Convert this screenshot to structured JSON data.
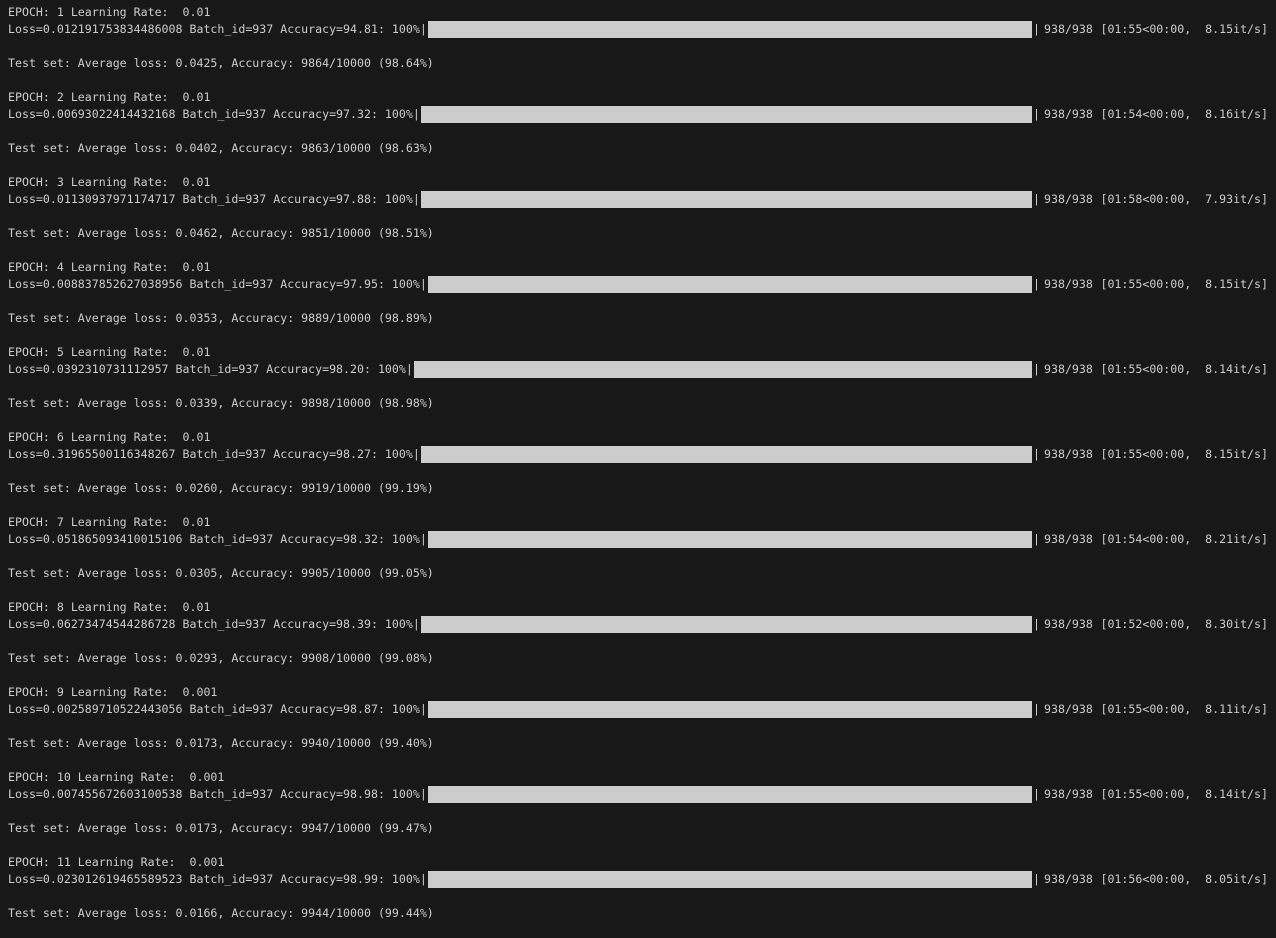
{
  "terminal": {
    "background": "#181818",
    "text_color": "#cccccc",
    "bar_color": "#cccccc",
    "epochs": [
      {
        "header": "EPOCH: 1 Learning Rate:  0.01",
        "progress_prefix": "Loss=0.012191753834486008 Batch_id=937 Accuracy=94.81: 100%",
        "progress_fraction": 1.0,
        "count": "938/938",
        "timing": "[01:55<00:00,  8.15it/s]",
        "test": "Test set: Average loss: 0.0425, Accuracy: 9864/10000 (98.64%)"
      },
      {
        "header": "EPOCH: 2 Learning Rate:  0.01",
        "progress_prefix": "Loss=0.00693022414432168 Batch_id=937 Accuracy=97.32: 100%",
        "progress_fraction": 1.0,
        "count": "938/938",
        "timing": "[01:54<00:00,  8.16it/s]",
        "test": "Test set: Average loss: 0.0402, Accuracy: 9863/10000 (98.63%)"
      },
      {
        "header": "EPOCH: 3 Learning Rate:  0.01",
        "progress_prefix": "Loss=0.01130937971174717 Batch_id=937 Accuracy=97.88: 100%",
        "progress_fraction": 1.0,
        "count": "938/938",
        "timing": "[01:58<00:00,  7.93it/s]",
        "test": "Test set: Average loss: 0.0462, Accuracy: 9851/10000 (98.51%)"
      },
      {
        "header": "EPOCH: 4 Learning Rate:  0.01",
        "progress_prefix": "Loss=0.008837852627038956 Batch_id=937 Accuracy=97.95: 100%",
        "progress_fraction": 1.0,
        "count": "938/938",
        "timing": "[01:55<00:00,  8.15it/s]",
        "test": "Test set: Average loss: 0.0353, Accuracy: 9889/10000 (98.89%)"
      },
      {
        "header": "EPOCH: 5 Learning Rate:  0.01",
        "progress_prefix": "Loss=0.0392310731112957 Batch_id=937 Accuracy=98.20: 100%",
        "progress_fraction": 1.0,
        "count": "938/938",
        "timing": "[01:55<00:00,  8.14it/s]",
        "test": "Test set: Average loss: 0.0339, Accuracy: 9898/10000 (98.98%)"
      },
      {
        "header": "EPOCH: 6 Learning Rate:  0.01",
        "progress_prefix": "Loss=0.31965500116348267 Batch_id=937 Accuracy=98.27: 100%",
        "progress_fraction": 1.0,
        "count": "938/938",
        "timing": "[01:55<00:00,  8.15it/s]",
        "test": "Test set: Average loss: 0.0260, Accuracy: 9919/10000 (99.19%)"
      },
      {
        "header": "EPOCH: 7 Learning Rate:  0.01",
        "progress_prefix": "Loss=0.051865093410015106 Batch_id=937 Accuracy=98.32: 100%",
        "progress_fraction": 1.0,
        "count": "938/938",
        "timing": "[01:54<00:00,  8.21it/s]",
        "test": "Test set: Average loss: 0.0305, Accuracy: 9905/10000 (99.05%)"
      },
      {
        "header": "EPOCH: 8 Learning Rate:  0.01",
        "progress_prefix": "Loss=0.06273474544286728 Batch_id=937 Accuracy=98.39: 100%",
        "progress_fraction": 1.0,
        "count": "938/938",
        "timing": "[01:52<00:00,  8.30it/s]",
        "test": "Test set: Average loss: 0.0293, Accuracy: 9908/10000 (99.08%)"
      },
      {
        "header": "EPOCH: 9 Learning Rate:  0.001",
        "progress_prefix": "Loss=0.002589710522443056 Batch_id=937 Accuracy=98.87: 100%",
        "progress_fraction": 1.0,
        "count": "938/938",
        "timing": "[01:55<00:00,  8.11it/s]",
        "test": "Test set: Average loss: 0.0173, Accuracy: 9940/10000 (99.40%)"
      },
      {
        "header": "EPOCH: 10 Learning Rate:  0.001",
        "progress_prefix": "Loss=0.007455672603100538 Batch_id=937 Accuracy=98.98: 100%",
        "progress_fraction": 1.0,
        "count": "938/938",
        "timing": "[01:55<00:00,  8.14it/s]",
        "test": "Test set: Average loss: 0.0173, Accuracy: 9947/10000 (99.47%)"
      },
      {
        "header": "EPOCH: 11 Learning Rate:  0.001",
        "progress_prefix": "Loss=0.023012619465589523 Batch_id=937 Accuracy=98.99: 100%",
        "progress_fraction": 1.0,
        "count": "938/938",
        "timing": "[01:56<00:00,  8.05it/s]",
        "test": "Test set: Average loss: 0.0166, Accuracy: 9944/10000 (99.44%)"
      }
    ]
  }
}
